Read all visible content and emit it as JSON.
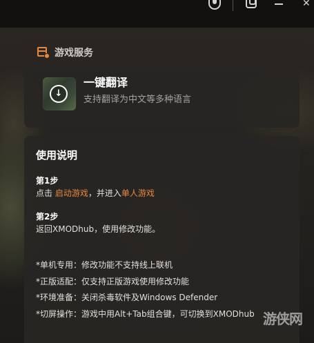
{
  "service_card": {
    "title": "游戏服务",
    "item": {
      "title": "一键翻译",
      "subtitle": "支持翻译为中文等多种语言"
    }
  },
  "guide": {
    "title": "使用说明",
    "step1": {
      "label": "第1步",
      "prefix": "点击 ",
      "link1": "启动游戏",
      "middle": "，并进入",
      "link2": "单人游戏"
    },
    "step2": {
      "label": "第2步",
      "text": "返回XMODhub，使用修改功能。"
    },
    "notes": [
      "*单机专用：修改功能不支持线上联机",
      "*正版适配：仅支持正版游戏使用修改功能",
      "*环境准备：关闭杀毒软件及Windows Defender",
      "*切屏操作：游戏中用Alt+Tab组合键，可切换到XMODhub"
    ]
  },
  "watermark": "游侠网",
  "colors": {
    "accent": "#e8883a",
    "card_bg": "#282623",
    "text_primary": "#ffffff",
    "text_secondary": "#a6a29c"
  },
  "icons": {
    "titlebar": [
      "app-logo-icon",
      "settings-icon",
      "minimize-icon",
      "close-icon"
    ],
    "service": "game-box-icon",
    "translate": "download-circle-icon"
  }
}
